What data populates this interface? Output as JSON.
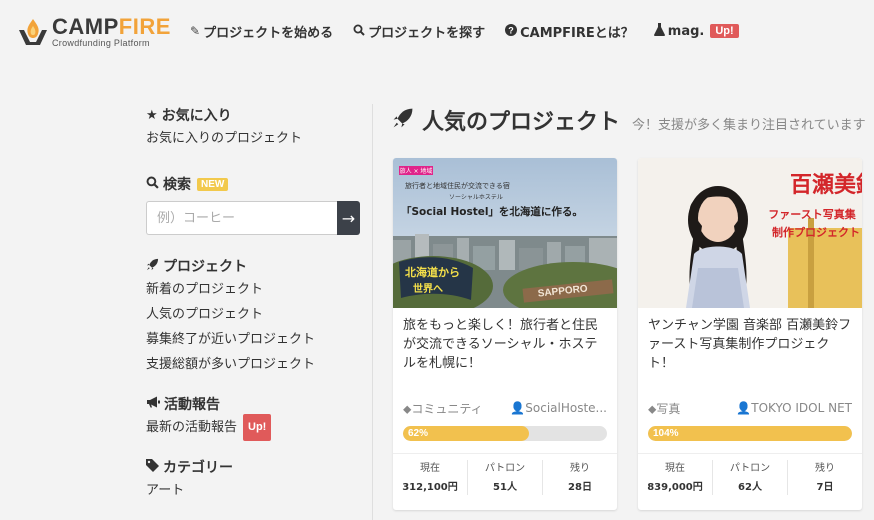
{
  "header": {
    "logo_word_1": "CAMP",
    "logo_word_2": "FIRE",
    "logo_tagline": "Crowdfunding Platform",
    "nav": [
      {
        "icon": "edit-icon",
        "label": "プロジェクトを始める"
      },
      {
        "icon": "search-icon",
        "label": "プロジェクトを探す"
      },
      {
        "icon": "question-circle-icon",
        "label": "CAMPFIREとは？"
      },
      {
        "icon": "flask-icon",
        "label": "mag.",
        "badge": "Up!"
      }
    ]
  },
  "sidebar": {
    "favorites": {
      "heading": "お気に入り",
      "links": [
        "お気に入りのプロジェクト"
      ]
    },
    "search": {
      "heading": "検索",
      "badge": "NEW",
      "placeholder": "例）コーヒー",
      "button": "→"
    },
    "projects": {
      "heading": "プロジェクト",
      "links": [
        "新着のプロジェクト",
        "人気のプロジェクト",
        "募集終了が近いプロジェクト",
        "支援総額が多いプロジェクト"
      ]
    },
    "reports": {
      "heading": "活動報告",
      "links": [
        "最新の活動報告"
      ],
      "badge": "Up!"
    },
    "categories": {
      "heading": "カテゴリー",
      "links": [
        "アート"
      ]
    }
  },
  "main": {
    "title": "人気のプロジェクト",
    "subtitle": "今！支援が多く集まり注目されています"
  },
  "cards": [
    {
      "image_text": {
        "tag": "旅人 × 地域",
        "line1": "旅行者と地域住民が交流できる宿",
        "line2": "ソーシャルホステル",
        "headline": "「Social Hostel」を北海道に作る。",
        "sign1": "北海道から",
        "sign2": "世界へ",
        "banner": "SAPPORO"
      },
      "title": "旅をもっと楽しく！旅行者と住民が交流できるソーシャル・ホステルを札幌に！",
      "category": "コミュニティ",
      "owner": "SocialHoste...",
      "progress_label": "62%",
      "progress_value": 62,
      "stats": [
        {
          "label": "現在",
          "value": "312,100円"
        },
        {
          "label": "パトロン",
          "value": "51人"
        },
        {
          "label": "残り",
          "value": "28日"
        }
      ]
    },
    {
      "image_text": {
        "name": "百瀬美鈴",
        "line1": "ファースト写真集",
        "line2": "制作プロジェクト"
      },
      "title": "ヤンチャン学園 音楽部 百瀬美鈴ファースト写真集制作プロジェクト！",
      "category": "写真",
      "owner": "TOKYO IDOL NET",
      "progress_label": "104%",
      "progress_value": 100,
      "stats": [
        {
          "label": "現在",
          "value": "839,000円"
        },
        {
          "label": "パトロン",
          "value": "62人"
        },
        {
          "label": "残り",
          "value": "7日"
        }
      ]
    }
  ],
  "colors": {
    "accent_yellow": "#f2c14e",
    "logo_orange": "#f2a33a",
    "badge_red": "#e05a5a",
    "badge_yellow": "#f2c94c",
    "dark_button": "#3c4149"
  }
}
